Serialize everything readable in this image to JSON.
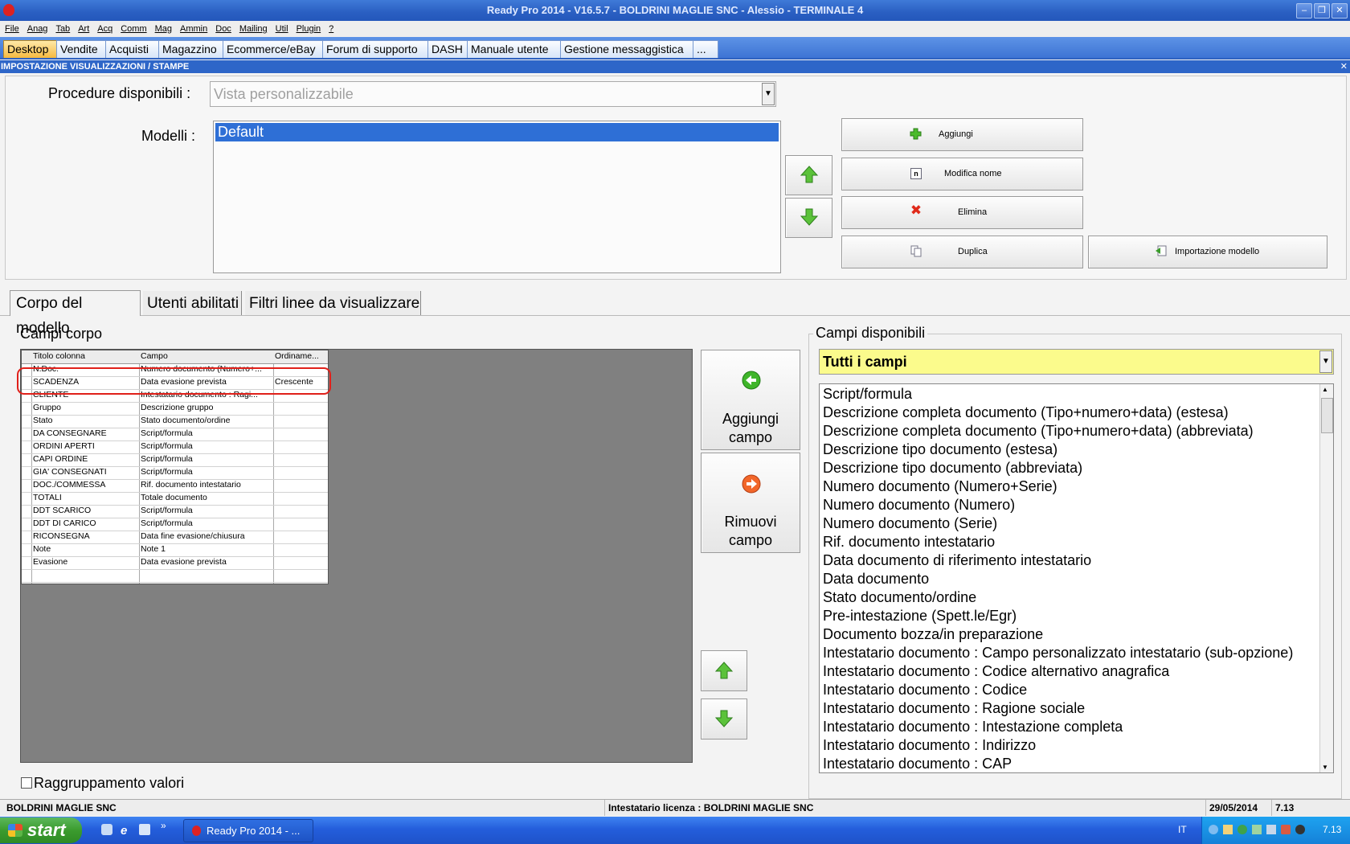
{
  "window": {
    "title": "Ready Pro 2014 - V16.5.7 - BOLDRINI MAGLIE SNC - Alessio - TERMINALE 4"
  },
  "menu": [
    "File",
    "Anag",
    "Tab",
    "Art",
    "Acq",
    "Comm",
    "Mag",
    "Ammin",
    "Doc",
    "Mailing",
    "Util",
    "Plugin",
    "?"
  ],
  "top_tabs": [
    "Desktop",
    "Vendite",
    "Acquisti",
    "Magazzino",
    "Ecommerce/eBay",
    "Forum di supporto",
    "DASH",
    "Manuale utente",
    "Gestione messaggistica",
    "..."
  ],
  "panel": {
    "title": "IMPOSTAZIONE VISUALIZZAZIONI / STAMPE",
    "close": "✕"
  },
  "procedure": {
    "label": "Procedure disponibili :",
    "value": "Vista personalizzabile"
  },
  "modelli": {
    "label": "Modelli :",
    "items": [
      "Default"
    ]
  },
  "buttons": {
    "aggiungi": "Aggiungi",
    "modifica": "Modifica nome",
    "elimina": "Elimina",
    "duplica": "Duplica",
    "importazione": "Importazione modello"
  },
  "subtabs": [
    "Corpo del modello",
    "Utenti abilitati",
    "Filtri linee da visualizzare"
  ],
  "campi_corpo": {
    "title": "Campi corpo",
    "headers": [
      "Titolo colonna",
      "Campo",
      "Ordiname..."
    ],
    "rows": [
      [
        "N.Doc.",
        "Numero documento (Numero+...",
        ""
      ],
      [
        "SCADENZA",
        "Data evasione prevista",
        "Crescente"
      ],
      [
        "CLIENTE",
        "Intestatario documento : Ragi...",
        ""
      ],
      [
        "Gruppo",
        "Descrizione gruppo",
        ""
      ],
      [
        "Stato",
        "Stato documento/ordine",
        ""
      ],
      [
        "DA CONSEGNARE",
        "Script/formula",
        ""
      ],
      [
        "ORDINI APERTI",
        "Script/formula",
        ""
      ],
      [
        "CAPI  ORDINE",
        "Script/formula",
        ""
      ],
      [
        "GIA' CONSEGNATI",
        "Script/formula",
        ""
      ],
      [
        "DOC./COMMESSA",
        "Rif. documento intestatario",
        ""
      ],
      [
        "TOTALI",
        "Totale documento",
        ""
      ],
      [
        "DDT SCARICO",
        "Script/formula",
        ""
      ],
      [
        "DDT DI  CARICO",
        "Script/formula",
        ""
      ],
      [
        "RICONSEGNA",
        "Data fine evasione/chiusura",
        ""
      ],
      [
        "Note",
        "Note 1",
        ""
      ],
      [
        "Evasione",
        "Data evasione prevista",
        ""
      ]
    ]
  },
  "middle_buttons": {
    "aggiungi_campo": [
      "Aggiungi",
      "campo"
    ],
    "rimuovi_campo": [
      "Rimuovi",
      "campo"
    ]
  },
  "campi_disponibili": {
    "title": "Campi disponibili",
    "filter": "Tutti i campi",
    "items": [
      "Script/formula",
      "Descrizione completa documento (Tipo+numero+data) (estesa)",
      "Descrizione completa documento (Tipo+numero+data) (abbreviata)",
      "Descrizione tipo documento (estesa)",
      "Descrizione tipo documento (abbreviata)",
      "Numero documento (Numero+Serie)",
      "Numero documento (Numero)",
      "Numero documento (Serie)",
      "Rif. documento intestatario",
      "Data documento di riferimento intestatario",
      "Data documento",
      "Stato documento/ordine",
      "Pre-intestazione (Spett.le/Egr)",
      "Documento bozza/in preparazione",
      "Intestatario documento : Campo personalizzato intestatario (sub-opzione)",
      "Intestatario documento : Codice alternativo anagrafica",
      "Intestatario documento : Codice",
      "Intestatario documento : Ragione sociale",
      "Intestatario documento : Intestazione completa",
      "Intestatario documento : Indirizzo",
      "Intestatario documento : CAP"
    ]
  },
  "raggruppamento": {
    "label": "Raggruppamento valori",
    "checked": false
  },
  "status": {
    "company": "BOLDRINI MAGLIE SNC",
    "license": "Intestatario licenza : BOLDRINI MAGLIE SNC",
    "date": "29/05/2014",
    "time": "7.13"
  },
  "taskbar": {
    "start": "start",
    "task": "Ready Pro 2014 - ...",
    "lang": "IT",
    "clock": "7.13"
  },
  "colors": {
    "title_blue": "#2e66c8",
    "selection": "#2e6fd6",
    "highlight_yellow": "#fbfb8c",
    "annotation_red": "#e0201a"
  }
}
